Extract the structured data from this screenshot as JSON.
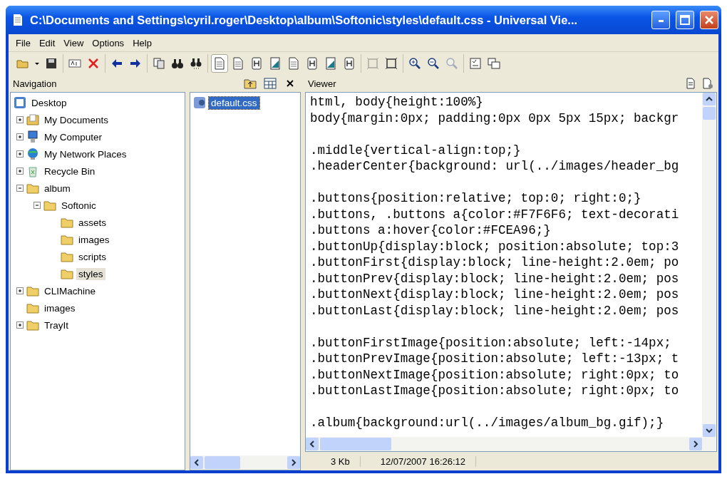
{
  "window": {
    "title": "C:\\Documents and Settings\\cyril.roger\\Desktop\\album\\Softonic\\styles\\default.css - Universal Vie..."
  },
  "menu": [
    "File",
    "Edit",
    "View",
    "Options",
    "Help"
  ],
  "toolbar": [
    [
      {
        "kind": "open",
        "selected": false,
        "disabled": false
      },
      {
        "kind": "dropdown",
        "selected": false,
        "disabled": false
      },
      {
        "kind": "save",
        "selected": false,
        "disabled": false
      }
    ],
    [
      {
        "kind": "rename",
        "selected": false,
        "disabled": false
      },
      {
        "kind": "delete",
        "selected": false,
        "disabled": false
      }
    ],
    [
      {
        "kind": "back",
        "selected": false,
        "disabled": false
      },
      {
        "kind": "forward",
        "selected": false,
        "disabled": false
      }
    ],
    [
      {
        "kind": "copy",
        "selected": false,
        "disabled": false
      },
      {
        "kind": "find",
        "selected": false,
        "disabled": false
      },
      {
        "kind": "findnext",
        "selected": false,
        "disabled": false
      }
    ],
    [
      {
        "kind": "page",
        "selected": true,
        "disabled": false
      },
      {
        "kind": "page",
        "selected": false,
        "disabled": false
      },
      {
        "kind": "hex",
        "selected": false,
        "disabled": false
      },
      {
        "kind": "image",
        "selected": false,
        "disabled": false
      },
      {
        "kind": "page",
        "selected": false,
        "disabled": false
      },
      {
        "kind": "hex",
        "selected": false,
        "disabled": false
      },
      {
        "kind": "image",
        "selected": false,
        "disabled": false
      },
      {
        "kind": "hex",
        "selected": false,
        "disabled": false
      }
    ],
    [
      {
        "kind": "fit",
        "selected": false,
        "disabled": true
      },
      {
        "kind": "fit",
        "selected": false,
        "disabled": false
      }
    ],
    [
      {
        "kind": "zoomin",
        "selected": false,
        "disabled": false
      },
      {
        "kind": "zoomout",
        "selected": false,
        "disabled": false
      },
      {
        "kind": "zoomreset",
        "selected": false,
        "disabled": true
      }
    ],
    [
      {
        "kind": "options",
        "selected": false,
        "disabled": false
      },
      {
        "kind": "windows",
        "selected": false,
        "disabled": false
      }
    ]
  ],
  "navigation": {
    "title": "Navigation",
    "tree": [
      {
        "label": "Desktop",
        "kind": "desktop",
        "selected": false,
        "children": [
          {
            "label": "My Documents",
            "kind": "documents",
            "selected": false,
            "expanded": false
          },
          {
            "label": "My Computer",
            "kind": "computer",
            "selected": false,
            "expanded": false
          },
          {
            "label": "My Network Places",
            "kind": "network",
            "selected": false,
            "expanded": false
          },
          {
            "label": "Recycle Bin",
            "kind": "recycle",
            "selected": false,
            "expanded": false
          },
          {
            "label": "album",
            "kind": "folder",
            "selected": false,
            "expanded": true,
            "children": [
              {
                "label": "Softonic",
                "kind": "folder",
                "selected": false,
                "expanded": true,
                "children": [
                  {
                    "label": "assets",
                    "kind": "folder",
                    "selected": false
                  },
                  {
                    "label": "images",
                    "kind": "folder",
                    "selected": false
                  },
                  {
                    "label": "scripts",
                    "kind": "folder",
                    "selected": false
                  },
                  {
                    "label": "styles",
                    "kind": "folder",
                    "selected": true
                  }
                ]
              }
            ]
          },
          {
            "label": "CLIMachine",
            "kind": "folder",
            "selected": false,
            "expanded": false
          },
          {
            "label": "images",
            "kind": "folder",
            "selected": false
          },
          {
            "label": "TrayIt",
            "kind": "folder",
            "selected": false,
            "expanded": false
          }
        ]
      }
    ]
  },
  "files": [
    {
      "name": "default.css",
      "selected": true
    }
  ],
  "viewer": {
    "title": "Viewer",
    "code_blocks": [
      [
        "html, body{height:100%}",
        "body{margin:0px; padding:0px 0px 5px 15px; backgr"
      ],
      [
        ".middle{vertical-align:top;}",
        ".headerCenter{background: url(../images/header_bg"
      ],
      [
        ".buttons{position:relative; top:0; right:0;}",
        ".buttons, .buttons a{color:#F7F6F6; text-decorati",
        ".buttons a:hover{color:#FCEA96;}",
        ".buttonUp{display:block; position:absolute; top:3",
        ".buttonFirst{display:block; line-height:2.0em; po",
        ".buttonPrev{display:block; line-height:2.0em; pos",
        ".buttonNext{display:block; line-height:2.0em; pos",
        ".buttonLast{display:block; line-height:2.0em; pos"
      ],
      [
        ".buttonFirstImage{position:absolute; left:-14px;",
        ".buttonPrevImage{position:absolute; left:-13px; t",
        ".buttonNextImage{position:absolute; right:0px; to",
        ".buttonLastImage{position:absolute; right:0px; to"
      ],
      [
        ".album{background:url(../images/album_bg.gif);}"
      ]
    ]
  },
  "status_bar": [
    "3 Kb",
    "12/07/2007 16:26:12"
  ]
}
